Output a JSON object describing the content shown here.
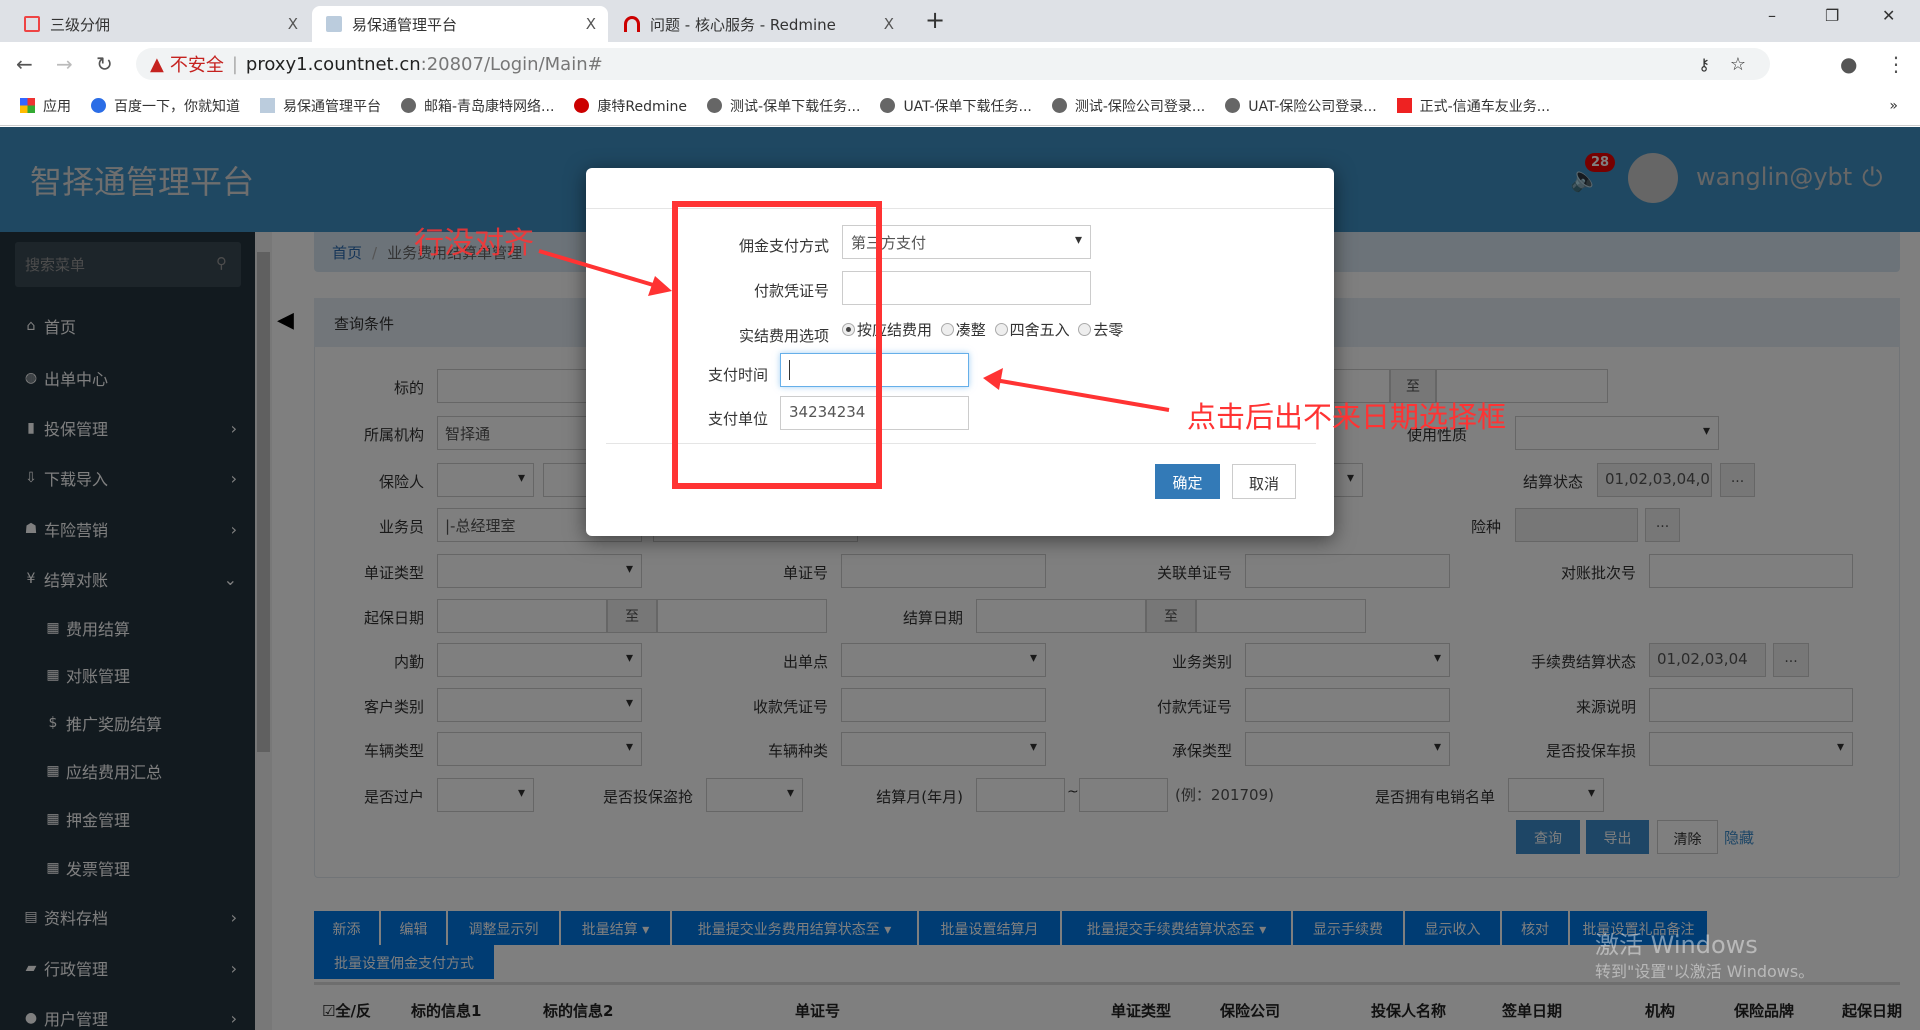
{
  "browser": {
    "tabs": [
      {
        "label": "三级分佣",
        "close": "X"
      },
      {
        "label": "易保通管理平台",
        "close": "X"
      },
      {
        "label": "问题 - 核心服务 - Redmine",
        "close": "X"
      }
    ],
    "new_tab": "+",
    "security": "不安全",
    "url_host": "proxy1.countnet.cn",
    "url_path": ":20807/Login/Main#",
    "bookmarks": [
      "应用",
      "百度一下，你就知道",
      "易保通管理平台",
      "邮箱-青岛康特网络...",
      "康特Redmine",
      "测试-保单下载任务...",
      "UAT-保单下载任务...",
      "测试-保险公司登录...",
      "UAT-保险公司登录...",
      "正式-信通车友业务..."
    ],
    "more": "»",
    "window_controls": [
      "–",
      "❐",
      "✕"
    ]
  },
  "header": {
    "title": "智择通管理平台",
    "badge": "28",
    "user": "wanglin@ybt"
  },
  "sidebar": {
    "search_placeholder": "搜索菜单",
    "items": [
      {
        "label": "首页",
        "icon": "⌂"
      },
      {
        "label": "出单中心",
        "icon": "◍"
      },
      {
        "label": "投保管理",
        "icon": "▮"
      },
      {
        "label": "下载导入",
        "icon": "⇩"
      },
      {
        "label": "车险营销",
        "icon": "☗"
      },
      {
        "label": "结算对账",
        "icon": "¥"
      },
      {
        "label": "资料存档",
        "icon": "▤"
      },
      {
        "label": "行政管理",
        "icon": "▰"
      },
      {
        "label": "用户管理",
        "icon": "●"
      }
    ],
    "sub_items": [
      {
        "label": "费用结算",
        "icon": "▦"
      },
      {
        "label": "对账管理",
        "icon": "▦"
      },
      {
        "label": "推广奖励结算",
        "icon": "$"
      },
      {
        "label": "应结费用汇总",
        "icon": "▦"
      },
      {
        "label": "押金管理",
        "icon": "▦"
      },
      {
        "label": "发票管理",
        "icon": "▦"
      }
    ]
  },
  "breadcrumb": {
    "home": "首页",
    "sep": "/",
    "current": "业务费用结算单管理"
  },
  "query": {
    "title": "查询条件",
    "to": "至",
    "labels": {
      "biaodi": "标的",
      "org": "所属机构",
      "insured": "保险人",
      "staff": "业务员",
      "doc_type": "单证类型",
      "doc_no": "单证号",
      "rel_doc_no": "关联单证号",
      "batch_no": "对账批次号",
      "start_date": "起保日期",
      "settle_date": "结算日期",
      "clerk": "内勤",
      "issue_point": "出单点",
      "biz_type": "业务类别",
      "fee_status": "手续费结算状态",
      "cust_type": "客户类别",
      "receipt_no": "收款凭证号",
      "pay_no": "付款凭证号",
      "source": "来源说明",
      "veh_type": "车辆类型",
      "veh_kind": "车辆种类",
      "uw_type": "承保类型",
      "car_damage": "是否投保车损",
      "transfer": "是否过户",
      "theft": "是否投保盗抢",
      "settle_month": "结算月(年月)",
      "telesales": "是否拥有电销名单",
      "usage": "使用性质",
      "settle_status": "结算状态",
      "risk": "险种"
    },
    "values": {
      "org": "智择通",
      "staff": "|-总经理室",
      "settle_status": "01,02,03,04,0",
      "fee_status": "01,02,03,04"
    },
    "ellipsis": "...",
    "tilde": "~",
    "month_hint": "(例：201709)",
    "buttons": {
      "search": "查询",
      "export": "导出",
      "clear": "清除",
      "hide": "隐藏"
    }
  },
  "toolbar": [
    "新添",
    "编辑",
    "调整显示列",
    "批量结算 ▾",
    "批量提交业务费用结算状态至 ▾",
    "批量设置结算月",
    "批量提交手续费结算状态至 ▾",
    "显示手续费",
    "显示收入",
    "核对",
    "批量设置礼品备注",
    "批量设置佣金支付方式"
  ],
  "table": {
    "headers": [
      "全/反",
      "标的信息1",
      "标的信息2",
      "单证号",
      "单证类型",
      "保险公司",
      "投保人名称",
      "签单日期",
      "机构",
      "保险品牌",
      "起保日期"
    ]
  },
  "modal": {
    "labels": {
      "method": "佣金支付方式",
      "voucher": "付款凭证号",
      "option": "实结费用选项",
      "time": "支付时间",
      "unit": "支付单位"
    },
    "method_value": "第三方支付",
    "options": [
      {
        "label": "按应结费用",
        "checked": true
      },
      {
        "label": "凑整",
        "checked": false
      },
      {
        "label": "四舍五入",
        "checked": false
      },
      {
        "label": "去零",
        "checked": false
      }
    ],
    "unit_value": "34234234",
    "ok": "确定",
    "cancel": "取消"
  },
  "annotations": {
    "misaligned": "行没对齐",
    "no_datepicker": "点击后出不来日期选择框"
  },
  "watermark": {
    "line1": "激活 Windows",
    "line2": "转到\"设置\"以激活 Windows。"
  }
}
